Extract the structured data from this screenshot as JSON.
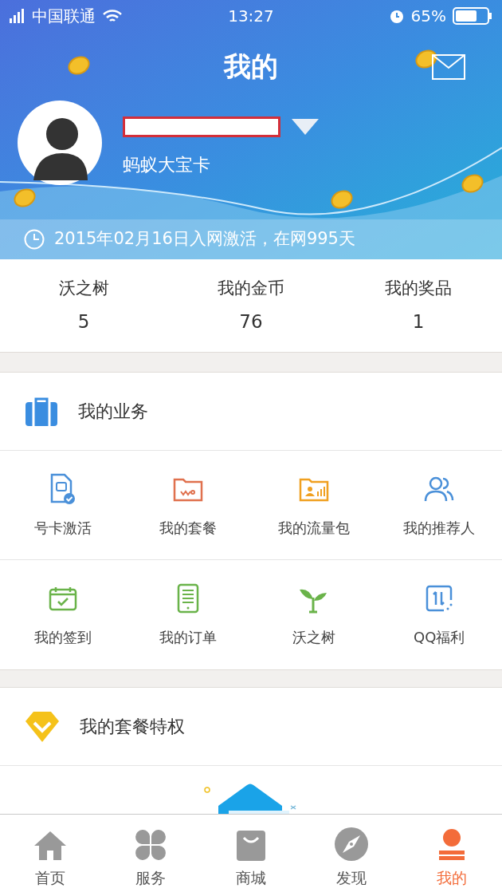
{
  "status_bar": {
    "carrier": "中国联通",
    "time": "13:27",
    "battery": "65%"
  },
  "header": {
    "title": "我的"
  },
  "profile": {
    "card_name": "蚂蚁大宝卡"
  },
  "activation": {
    "text": "2015年02月16日入网激活，在网995天"
  },
  "stats": [
    {
      "label": "沃之树",
      "value": "5"
    },
    {
      "label": "我的金币",
      "value": "76"
    },
    {
      "label": "我的奖品",
      "value": "1"
    }
  ],
  "business": {
    "title": "我的业务",
    "items": [
      {
        "label": "号卡激活"
      },
      {
        "label": "我的套餐"
      },
      {
        "label": "我的流量包"
      },
      {
        "label": "我的推荐人"
      },
      {
        "label": "我的签到"
      },
      {
        "label": "我的订单"
      },
      {
        "label": "沃之树"
      },
      {
        "label": "QQ福利"
      }
    ]
  },
  "privileges": {
    "title": "我的套餐特权"
  },
  "tab_bar": [
    {
      "label": "首页",
      "selected": false
    },
    {
      "label": "服务",
      "selected": false
    },
    {
      "label": "商城",
      "selected": false
    },
    {
      "label": "发现",
      "selected": false
    },
    {
      "label": "我的",
      "selected": true
    }
  ]
}
